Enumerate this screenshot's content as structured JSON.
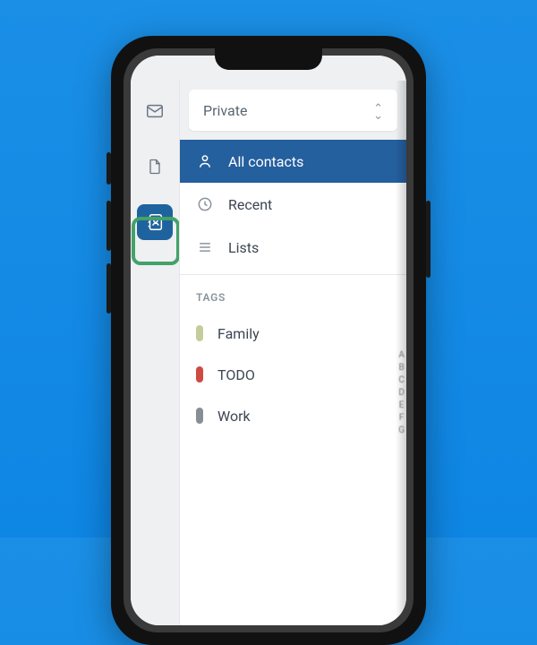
{
  "dropdown": {
    "selected": "Private"
  },
  "nav": {
    "all_contacts": "All contacts",
    "recent": "Recent",
    "lists": "Lists"
  },
  "tags_header": "TAGS",
  "tags": [
    {
      "label": "Family",
      "color": "#c5cc9c"
    },
    {
      "label": "TODO",
      "color": "#cf4a43"
    },
    {
      "label": "Work",
      "color": "#888e94"
    }
  ]
}
